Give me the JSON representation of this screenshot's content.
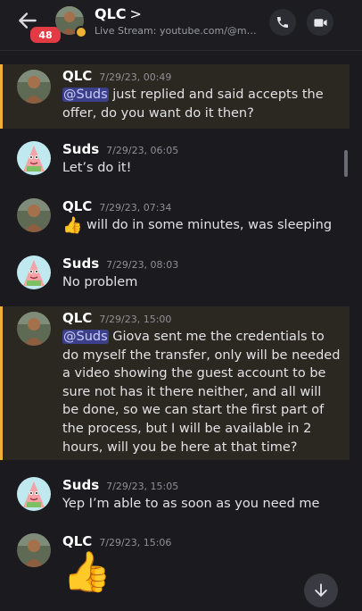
{
  "header": {
    "unread_count": "48",
    "title": "QLC",
    "chevron": ">",
    "subtitle": "Live Stream: youtube.com/@meto...",
    "icons": [
      "back-arrow-icon",
      "phone-icon",
      "video-camera-icon"
    ]
  },
  "messages": [
    {
      "author": "QLC",
      "time": "7/29/23, 00:49",
      "mention": "@Suds",
      "text": " just replied and said accepts the offer, do you want do it then?",
      "highlighted": true
    },
    {
      "author": "Suds",
      "time": "7/29/23, 06:05",
      "text": "Let’s do it!"
    },
    {
      "author": "QLC",
      "time": "7/29/23, 07:34",
      "emoji": "👍",
      "text": " will do in some minutes, was sleeping"
    },
    {
      "author": "Suds",
      "time": "7/29/23, 08:03",
      "text": "No problem"
    },
    {
      "author": "QLC",
      "time": "7/29/23, 15:00",
      "mention": "@Suds",
      "text": " Giova sent me the credentials to do myself the transfer, only will be needed a video showing the guest account to be sure not has it there neither, and all will be done, so we can start the first part of the process, but I will be available in 2 hours, will you be here at that time?",
      "highlighted": true
    },
    {
      "author": "Suds",
      "time": "7/29/23, 15:05",
      "text": "Yep I’m able to as soon as you need me"
    },
    {
      "author": "QLC",
      "time": "7/29/23, 15:06",
      "big_emoji": "👍"
    }
  ],
  "colors": {
    "highlight_bar": "#f0b232",
    "badge": "#e23b43",
    "mention_bg": "#3c3f8a"
  }
}
